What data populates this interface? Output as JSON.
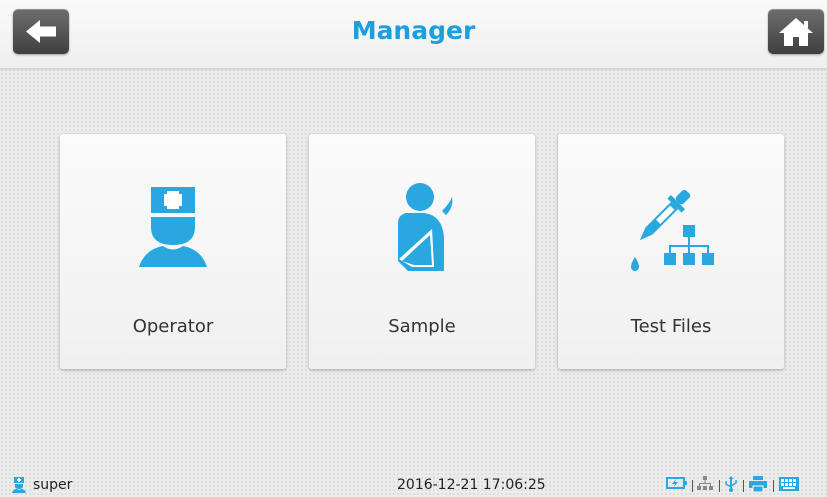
{
  "header": {
    "title": "Manager",
    "back_icon": "arrow-left-icon",
    "home_icon": "home-icon"
  },
  "cards": [
    {
      "label": "Operator",
      "icon": "operator-nurse-icon"
    },
    {
      "label": "Sample",
      "icon": "sample-patient-icon"
    },
    {
      "label": "Test Files",
      "icon": "dropper-hierarchy-icon"
    }
  ],
  "status": {
    "user": "super",
    "datetime": "2016-12-21 17:06:25",
    "icons": [
      "battery-charging-icon",
      "network-icon",
      "usb-icon",
      "printer-icon",
      "keyboard-icon"
    ]
  },
  "colors": {
    "accent": "#1a9fe0",
    "icon_blue": "#29a8e0",
    "button_dark": "#4a4a4a"
  }
}
